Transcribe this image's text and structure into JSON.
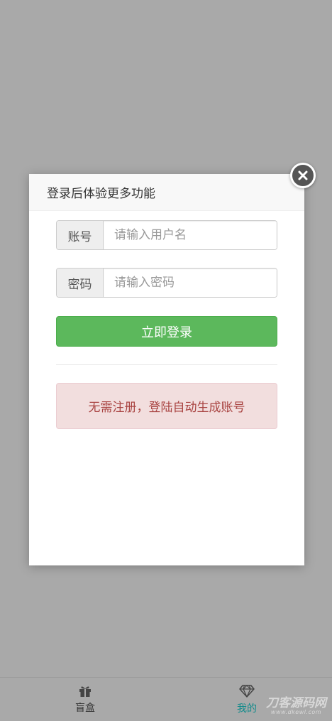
{
  "modal": {
    "title": "登录后体验更多功能",
    "username": {
      "label": "账号",
      "placeholder": "请输入用户名",
      "value": ""
    },
    "password": {
      "label": "密码",
      "placeholder": "请输入密码",
      "value": ""
    },
    "login_button": "立即登录",
    "notice": "无需注册，登陆自动生成账号",
    "close_icon": "close-icon"
  },
  "bottom_nav": {
    "items": [
      {
        "label": "盲盒",
        "icon": "gift-icon",
        "active": false
      },
      {
        "label": "我的",
        "icon": "diamond-icon",
        "active": true
      }
    ]
  },
  "watermark": {
    "text": "刀客源码网",
    "sub": "www.dkewl.com"
  },
  "colors": {
    "overlay": "#a9a9a9",
    "primary_button": "#5cb85c",
    "alert_bg": "#f2dede",
    "alert_text": "#a94442",
    "nav_active": "#0e8a8a"
  }
}
